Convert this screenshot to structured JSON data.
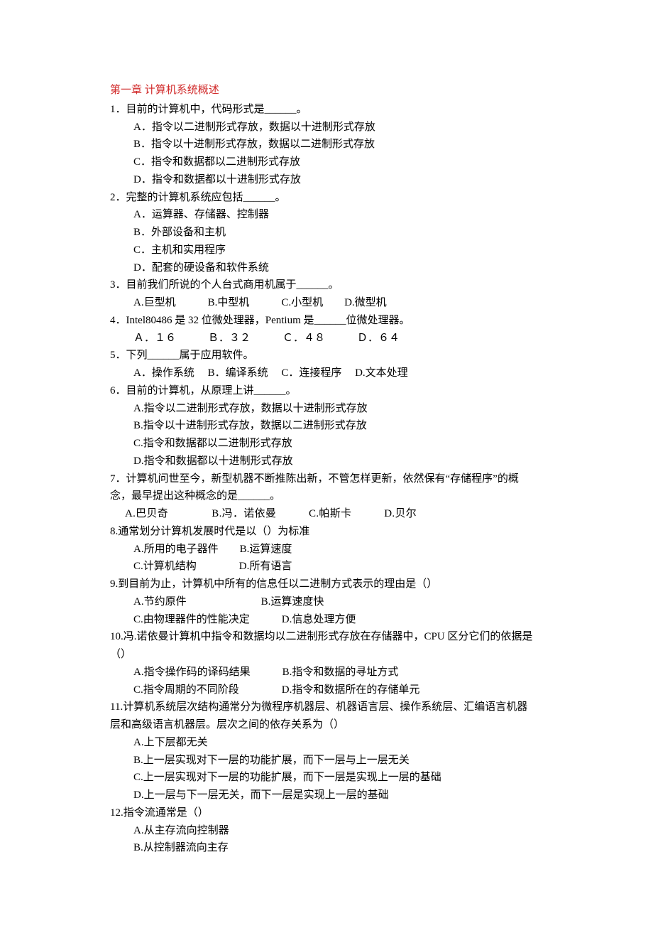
{
  "chapter_title": "第一章 计算机系统概述",
  "q1": {
    "stem": "1．目前的计算机中，代码形式是______。",
    "a": "A．指令以二进制形式存放，数据以十进制形式存放",
    "b": "B．指令以十进制形式存放，数据以二进制形式存放",
    "c": "C．指令和数据都以二进制形式存放",
    "d": "D．指令和数据都以十进制形式存放"
  },
  "q2": {
    "stem": "2．完整的计算机系统应包括______。",
    "a": "A．运算器、存储器、控制器",
    "b": "B．外部设备和主机",
    "c": "C．主机和实用程序",
    "d": "D．配套的硬设备和软件系统"
  },
  "q3": {
    "stem": "3．目前我们所说的个人台式商用机属于______。",
    "opts": "A.巨型机　　　B.中型机　　　C.小型机　　D.微型机"
  },
  "q4": {
    "stem": "4．Intel80486 是 32 位微处理器，Pentium 是______位微处理器。",
    "opts": "Ａ．１６　　　Ｂ．３２　　　Ｃ．４８　　　Ｄ．６４"
  },
  "q5": {
    "stem": "5．下列______属于应用软件。",
    "opts": "A．操作系统　 B．编译系统　 C．连接程序　 D.文本处理"
  },
  "q6": {
    "stem": "6．目前的计算机，从原理上讲______。",
    "a": "A.指令以二进制形式存放，数据以十进制形式存放",
    "b": "B.指令以十进制形式存放，数据以二进制形式存放",
    "c": "C.指令和数据都以二进制形式存放",
    "d": "D.指令和数据都以十进制形式存放"
  },
  "q7": {
    "stem1": "7．计算机问世至今，新型机器不断推陈出新，不管怎样更新，依然保有“存储程序”的概",
    "stem2": "念，最早提出这种概念的是______。",
    "opts": "A.巴贝奇　　　　B.冯．诺依曼　　　C.帕斯卡　　　D.贝尔"
  },
  "q8": {
    "stem": "8.通常划分计算机发展时代是以（）为标准",
    "line1": "A.所用的电子器件　　B.运算速度",
    "line2": "C.计算机结构　　　　D.所有语言"
  },
  "q9": {
    "stem": "9.到目前为止，计算机中所有的信息任以二进制方式表示的理由是（）",
    "line1": "A.节约原件　　　　　　　B.运算速度快",
    "line2": "C.由物理器件的性能决定　　　D.信息处理方便"
  },
  "q10": {
    "stem1": "10.冯.诺依曼计算机中指令和数据均以二进制形式存放在存储器中，CPU 区分它们的依据是",
    "stem2": "（）",
    "line1": "A.指令操作码的译码结果　　　B.指令和数据的寻址方式",
    "line2": "C.指令周期的不同阶段　　　　D.指令和数据所在的存储单元"
  },
  "q11": {
    "stem1": "11.计算机系统层次结构通常分为微程序机器层、机器语言层、操作系统层、汇编语言机器",
    "stem2": "层和高级语言机器层。层次之间的依存关系为（）",
    "a": "A.上下层都无关",
    "b": "B.上一层实现对下一层的功能扩展，而下一层与上一层无关",
    "c": "C.上一层实现对下一层的功能扩展，而下一层是实现上一层的基础",
    "d": "D.上一层与下一层无关，而下一层是实现上一层的基础"
  },
  "q12": {
    "stem": "12.指令流通常是（）",
    "a": "A.从主存流向控制器",
    "b": "B.从控制器流向主存"
  }
}
